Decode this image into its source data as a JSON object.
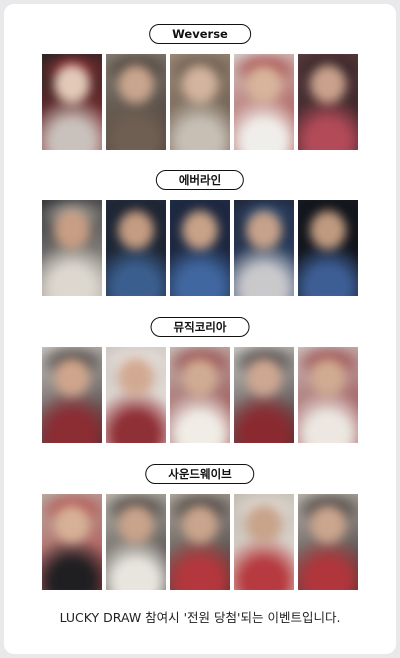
{
  "sections": [
    {
      "label": "Weverse",
      "photos": [
        {
          "bg": "#222",
          "mid": "#c9c1bb",
          "acc": "#9a2e32",
          "skin": "#e2c9b8"
        },
        {
          "bg": "#8b8377",
          "mid": "#6f5f52",
          "acc": "#3a2f2a",
          "skin": "#c9a58e"
        },
        {
          "bg": "#a08d7b",
          "mid": "#c7bfb4",
          "acc": "#5b4c3f",
          "skin": "#d3b49e"
        },
        {
          "bg": "#d9d7d2",
          "mid": "#f0eeea",
          "acc": "#9c2a2a",
          "skin": "#d7b49b"
        },
        {
          "bg": "#5a3c3f",
          "mid": "#b24a58",
          "acc": "#2c1c1f",
          "skin": "#c9a18c"
        }
      ]
    },
    {
      "label": "에버라인",
      "photos": [
        {
          "bg": "#2a2c33",
          "mid": "#dcd7cf",
          "acc": "#b7b0a4",
          "skin": "#c89e84"
        },
        {
          "bg": "#202a3c",
          "mid": "#3a5f8f",
          "acc": "#1b1f2a",
          "skin": "#c49c82"
        },
        {
          "bg": "#1e2a44",
          "mid": "#4067a0",
          "acc": "#1b243a",
          "skin": "#c8a287"
        },
        {
          "bg": "#1f2230",
          "mid": "#c9c9cc",
          "acc": "#2e4f7c",
          "skin": "#c7a28a"
        },
        {
          "bg": "#151820",
          "mid": "#3d5e95",
          "acc": "#0f1117",
          "skin": "#c09a80"
        }
      ]
    },
    {
      "label": "뮤직코리아",
      "photos": [
        {
          "bg": "#d2cdc7",
          "mid": "#8c2c33",
          "acc": "#2a2425",
          "skin": "#cfa58c"
        },
        {
          "bg": "#cbc3bf",
          "mid": "#8f2f36",
          "acc": "#efe9e4",
          "skin": "#d2aa92"
        },
        {
          "bg": "#c9c3bb",
          "mid": "#f0ece6",
          "acc": "#8a2c30",
          "skin": "#d0ab93"
        },
        {
          "bg": "#d4d0cb",
          "mid": "#8a2a30",
          "acc": "#2b2627",
          "skin": "#cda791"
        },
        {
          "bg": "#cfc9c3",
          "mid": "#ece7e1",
          "acc": "#8d2c32",
          "skin": "#d0aa91"
        }
      ]
    },
    {
      "label": "사운드웨이브",
      "photos": [
        {
          "bg": "#b9b1a6",
          "mid": "#1f1f22",
          "acc": "#b13a3c",
          "skin": "#d6b196"
        },
        {
          "bg": "#c6c0b6",
          "mid": "#e8e4de",
          "acc": "#2a2625",
          "skin": "#c9a38b"
        },
        {
          "bg": "#b7aea3",
          "mid": "#b3373c",
          "acc": "#2a2626",
          "skin": "#caa48c"
        },
        {
          "bg": "#bfb7ad",
          "mid": "#b63a3f",
          "acc": "#e9e4de",
          "skin": "#c9a38a"
        },
        {
          "bg": "#c3bbb2",
          "mid": "#b0363b",
          "acc": "#262223",
          "skin": "#cba58d"
        }
      ]
    }
  ],
  "footer": "LUCKY DRAW 참여시 '전원 당첨'되는 이벤트입니다."
}
